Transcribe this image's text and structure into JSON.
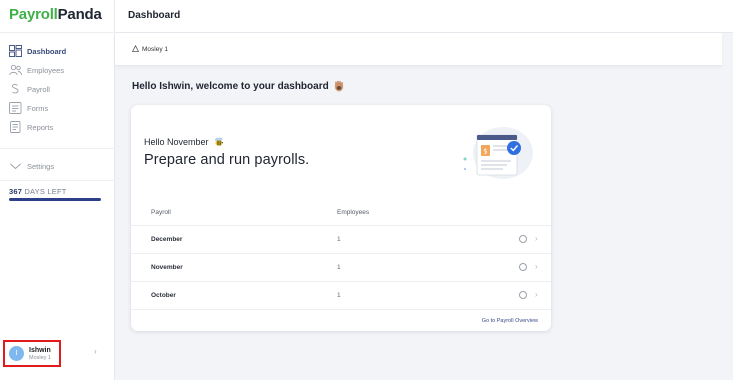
{
  "app": {
    "logo_part1": "Payroll",
    "logo_part2": "Panda",
    "accent": "#3eb14b"
  },
  "sidebar": {
    "items": [
      {
        "label": "Dashboard",
        "icon": "dashboard-icon",
        "active": true
      },
      {
        "label": "Employees",
        "icon": "employees-icon",
        "active": false
      },
      {
        "label": "Payroll",
        "icon": "payroll-icon",
        "active": false
      },
      {
        "label": "Forms",
        "icon": "forms-icon",
        "active": false
      },
      {
        "label": "Reports",
        "icon": "reports-icon",
        "active": false
      }
    ],
    "settings_label": "Settings",
    "days_left_number": "367",
    "days_left_text": "DAYS LEFT",
    "days_left_progress": 1.0
  },
  "user": {
    "initial": "I",
    "name": "Ishwin",
    "company": "Mosley 1"
  },
  "header": {
    "title": "Dashboard"
  },
  "breadcrumb": {
    "company": "Mosley 1"
  },
  "welcome": {
    "text": "Hello Ishwin, welcome to your dashboard"
  },
  "card": {
    "subtitle": "Hello November",
    "title": "Prepare and run payrolls.",
    "columns": {
      "payroll": "Payroll",
      "employees": "Employees"
    },
    "rows": [
      {
        "month": "December",
        "employees": "1"
      },
      {
        "month": "November",
        "employees": "1"
      },
      {
        "month": "October",
        "employees": "1"
      }
    ],
    "footer_link": "Go to Payroll Overview"
  }
}
